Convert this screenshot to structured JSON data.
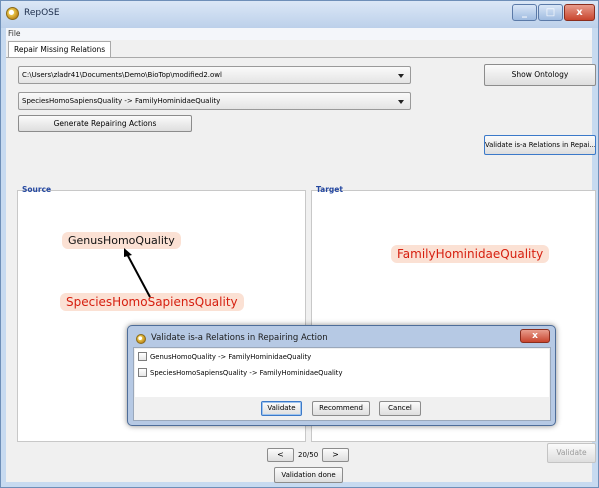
{
  "window": {
    "title": "RepOSE"
  },
  "menu": {
    "file": "File"
  },
  "tabs": [
    {
      "label": "Repair Missing Relations"
    }
  ],
  "ontology_path": "C:\\Users\\zladr41\\Documents\\Demo\\BioTop\\modified2.owl",
  "relation_selected": "SpeciesHomoSapiensQuality -> FamilyHominidaeQuality",
  "buttons": {
    "show_ontology": "Show Ontology",
    "generate": "Generate Repairing Actions",
    "validate_is_a": "Validate is-a Relations in Repai...",
    "prev": "<",
    "next": ">",
    "validate_disabled": "Validate",
    "validation_done": "Validation done"
  },
  "pager": {
    "text": "20/50"
  },
  "source": {
    "title": "Source",
    "nodes": {
      "genus": "GenusHomoQuality",
      "species": "SpeciesHomoSapiensQuality"
    }
  },
  "target": {
    "title": "Target",
    "nodes": {
      "family": "FamilyHominidaeQuality"
    }
  },
  "dialog": {
    "title": "Validate is-a Relations in Repairing Action",
    "close": "x",
    "items": [
      {
        "label": "GenusHomoQuality -> FamilyHominidaeQuality",
        "checked": false
      },
      {
        "label": "SpeciesHomoSapiensQuality -> FamilyHominidaeQuality",
        "checked": false
      }
    ],
    "buttons": {
      "validate": "Validate",
      "recommend": "Recommend",
      "cancel": "Cancel"
    }
  },
  "colors": {
    "window_bg": "#c7daf0",
    "node_bg": "#fbe1d4",
    "red_text": "#d61f0f",
    "panel_title": "#2548a0"
  }
}
